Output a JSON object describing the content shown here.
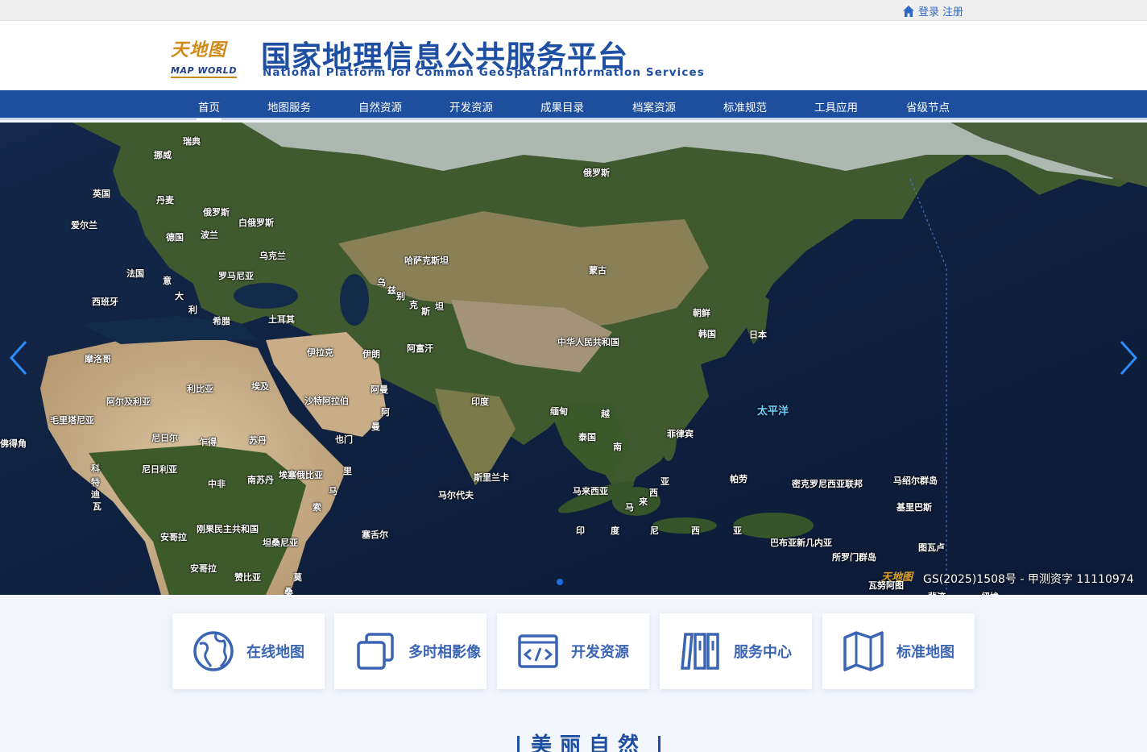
{
  "topbar": {
    "login": "登录",
    "register": "注册",
    "icon": "home-icon"
  },
  "header": {
    "logo_cn": "天地图",
    "logo_en": "MAP WORLD",
    "title": "国家地理信息公共服务平台",
    "subtitle": "National Platform for Common GeoSpatial Information Services"
  },
  "nav": {
    "items": [
      "首页",
      "地图服务",
      "自然资源",
      "开发资源",
      "成果目录",
      "档案资源",
      "标准规范",
      "工具应用",
      "省级节点"
    ],
    "active": "首页"
  },
  "banner": {
    "labels": {
      "ruidian": "瑞典",
      "nuowei": "挪威",
      "yingguo": "英国",
      "danmai": "丹麦",
      "eluosi_w": "俄罗斯",
      "aierlan": "爱尔兰",
      "baieluosi": "白俄罗斯",
      "deguo": "德国",
      "bolan": "波兰",
      "wukelan": "乌克兰",
      "faguo": "法国",
      "luomaniya": "罗马尼亚",
      "yi": "意",
      "da": "大",
      "li": "利",
      "xibanya": "西班牙",
      "xila": "希腊",
      "tuerqi": "土耳其",
      "eluosi": "俄罗斯",
      "hasakesitan": "哈萨克斯坦",
      "menggu": "蒙古",
      "wu": "乌",
      "zi": "兹",
      "bie": "别",
      "ke": "克",
      "si": "斯",
      "tan": "坦",
      "chaoxian": "朝鲜",
      "hanguo": "韩国",
      "riben": "日本",
      "zhonghua": "中华人民共和国",
      "afuhan": "阿富汗",
      "yilake": "伊拉克",
      "yilang": "伊朗",
      "moluoge": "摩洛哥",
      "libiya": "利比亚",
      "aiji": "埃及",
      "aerjiliya": "阿尔及利亚",
      "shatealabo": "沙特阿拉伯",
      "aman": "阿曼",
      "a": "阿",
      "man": "曼",
      "maolitaniya": "毛里塔尼亚",
      "yindu": "印度",
      "miandian": "缅甸",
      "yue": "越",
      "taiguo": "泰国",
      "nan": "南",
      "feilvbin": "菲律宾",
      "taipingyang": "太平洋",
      "fodejiao": "佛得角",
      "niriner": "尼日尔",
      "zhade": "乍得",
      "sudan": "苏丹",
      "yemen": "也门",
      "ke2": "科",
      "te": "特",
      "di": "迪",
      "wa": "瓦",
      "niriliya": "尼日利亚",
      "zhongfei": "中非",
      "nansudan": "南苏丹",
      "aisaiebiya": "埃塞俄比亚",
      "li2": "里",
      "ma": "马",
      "suo": "索",
      "sililanka": "斯里兰卡",
      "maerdaifu": "马尔代夫",
      "malaixiya": "马来西亚",
      "xi": "西",
      "lai": "来",
      "ma2": "马",
      "ya": "亚",
      "palao": "帕劳",
      "mikeluoniya": "密克罗尼西亚联邦",
      "mashaoer": "马绍尔群岛",
      "jilibasi": "基里巴斯",
      "yin": "印",
      "du": "度",
      "ni": "尼",
      "xi2": "西",
      "ya2": "亚",
      "bubuyaxinjineiya": "巴布亚新几内亚",
      "tuwalu": "图瓦卢",
      "suoluomen": "所罗门群岛",
      "anggela": "安哥拉",
      "gangguo": "刚果民主共和国",
      "tansangniya": "坦桑尼亚",
      "saisheer": "塞舌尔",
      "anggela2": "安哥拉",
      "zanbiya": "赞比亚",
      "mo": "莫",
      "sang": "桑",
      "wanuatu": "瓦努阿图",
      "feiji": "斐济",
      "niuyue": "纽埃"
    },
    "watermark": "天地图",
    "copyright": "GS(2025)1508号 - 甲测资字 11110974"
  },
  "cards": [
    {
      "label": "在线地图",
      "icon": "globe-icon"
    },
    {
      "label": "多时相影像",
      "icon": "layers-icon"
    },
    {
      "label": "开发资源",
      "icon": "code-icon"
    },
    {
      "label": "服务中心",
      "icon": "books-icon"
    },
    {
      "label": "标准地图",
      "icon": "folded-map-icon"
    }
  ],
  "section": {
    "title": "美丽自然"
  },
  "colors": {
    "nav_bg": "#1e4f9e",
    "title_blue": "#1e4fa3",
    "logo_gold": "#d08a17",
    "ocean": "#0d1f3e",
    "link_blue": "#2f67c8"
  }
}
